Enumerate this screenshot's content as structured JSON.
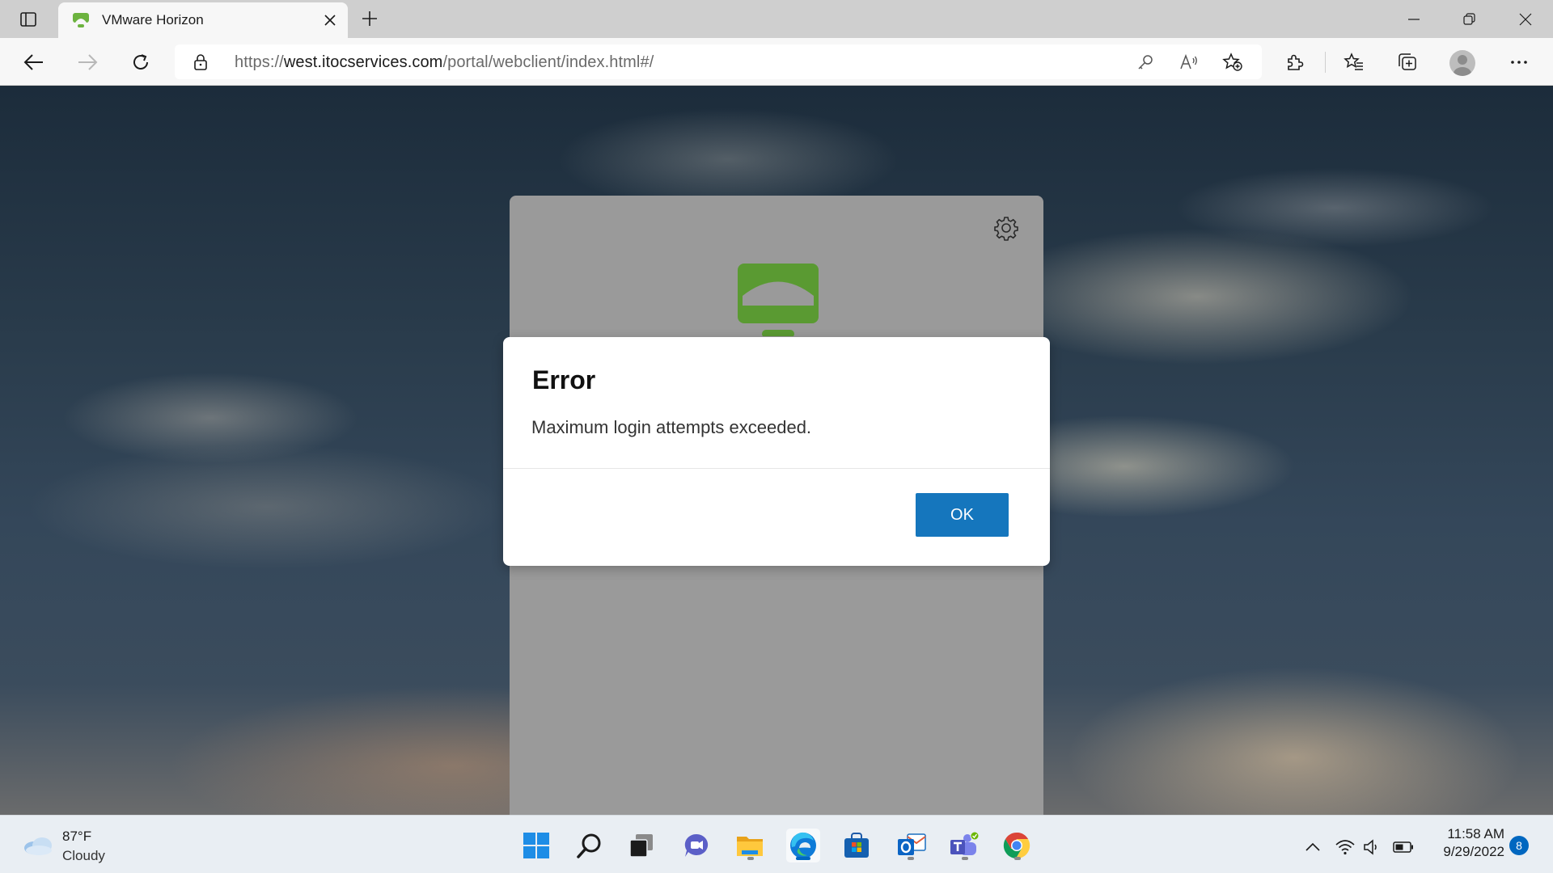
{
  "browser": {
    "tab_title": "VMware Horizon",
    "url_prefix": "https://",
    "url_host": "west.itocservices.com",
    "url_path": "/portal/webclient/index.html#/"
  },
  "login_panel": {
    "background": "#9a9a9a",
    "logo_color": "#5a9a32"
  },
  "dialog": {
    "title": "Error",
    "message": "Maximum login attempts exceeded.",
    "ok_label": "OK",
    "ok_color": "#1576bd"
  },
  "taskbar": {
    "weather_temp": "87°F",
    "weather_condition": "Cloudy",
    "apps": [
      "start",
      "search",
      "task-view",
      "chat",
      "file-explorer",
      "edge",
      "store",
      "outlook",
      "teams",
      "chrome"
    ],
    "active_app": "edge",
    "clock_time": "11:58 AM",
    "clock_date": "9/29/2022",
    "notification_count": "8"
  }
}
